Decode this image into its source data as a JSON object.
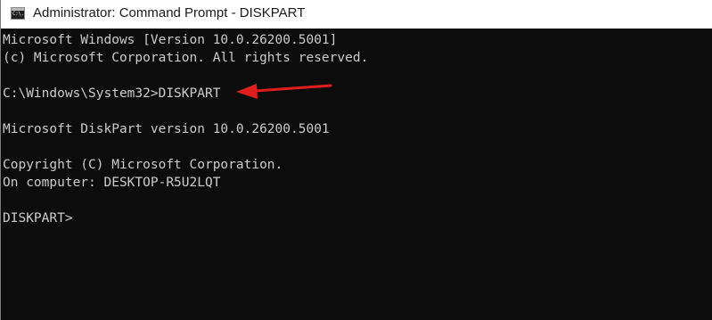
{
  "window": {
    "title": "Administrator: Command Prompt - DISKPART",
    "icon_text": "C:\\."
  },
  "console": {
    "lines": [
      "Microsoft Windows [Version 10.0.26200.5001]",
      "(c) Microsoft Corporation. All rights reserved.",
      "",
      "C:\\Windows\\System32>DISKPART",
      "",
      "Microsoft DiskPart version 10.0.26200.5001",
      "",
      "Copyright (C) Microsoft Corporation.",
      "On computer: DESKTOP-R5U2LQT",
      "",
      "DISKPART>"
    ]
  },
  "annotation": {
    "icon": "arrow-left-icon",
    "color": "#e01e1e"
  },
  "colors": {
    "console_background": "#0c0c0c",
    "console_text": "#cccccc",
    "titlebar_background": "#ffffff"
  }
}
